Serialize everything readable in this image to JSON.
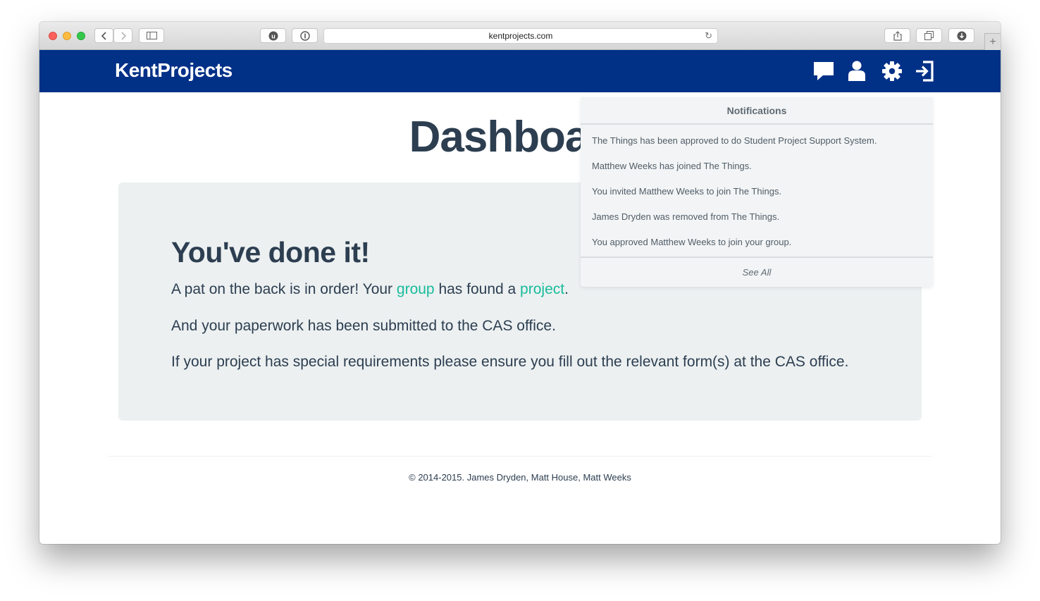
{
  "browser": {
    "url": "kentprojects.com",
    "colors": {
      "toolbar": "#d6d6d6",
      "close": "#fc605c",
      "minimize": "#fdbc40",
      "zoom": "#34c84a"
    }
  },
  "navbar": {
    "brand": "KentProjects",
    "background": "#013087",
    "icons": [
      "chat-icon",
      "user-icon",
      "gear-icon",
      "sign-out-icon"
    ]
  },
  "page": {
    "title": "Dashboard",
    "jumbotron": {
      "heading": "You've done it!",
      "line1_before": "A pat on the back is in order! Your ",
      "line1_link1": "group",
      "line1_middle": " has found a ",
      "line1_link2": "project",
      "line1_end": ".",
      "line2": "And your paperwork has been submitted to the CAS office.",
      "line3": "If your project has special requirements please ensure you fill out the relevant form(s) at the CAS office."
    },
    "footer": "© 2014-2015. James Dryden, Matt House, Matt Weeks",
    "colors": {
      "text": "#2c3e50",
      "link": "#18bc9c",
      "panel": "#ecf0f1"
    }
  },
  "notifications": {
    "header": "Notifications",
    "items": [
      "The Things has been approved to do Student Project Support System.",
      "Matthew Weeks has joined The Things.",
      "You invited Matthew Weeks to join The Things.",
      "James Dryden was removed from The Things.",
      "You approved Matthew Weeks to join your group."
    ],
    "see_all": "See All"
  }
}
